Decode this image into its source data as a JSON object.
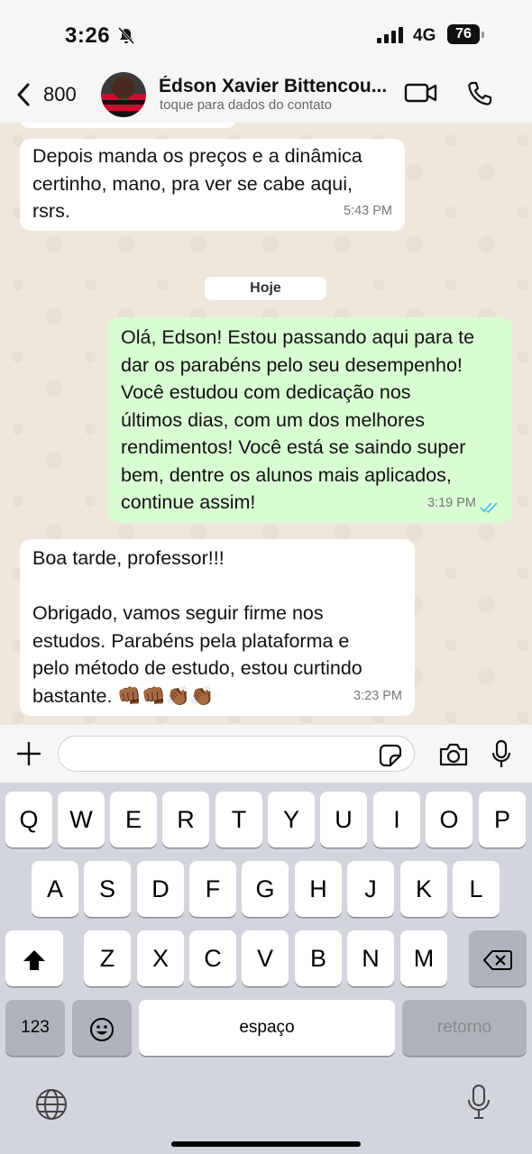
{
  "status_bar": {
    "time": "3:26",
    "network": "4G",
    "battery": "76"
  },
  "header": {
    "back_count": "800",
    "contact_name": "Édson Xavier Bittencou...",
    "contact_subtitle": "toque para dados do contato"
  },
  "messages": [
    {
      "direction": "in",
      "text": "Depois manda os preços e a dinâmica\ncertinho, mano, pra ver se cabe aqui,\nrsrs.",
      "time": "5:43 PM"
    },
    {
      "direction": "date",
      "text": "Hoje"
    },
    {
      "direction": "out",
      "text": "Olá, Edson! Estou passando aqui para te\ndar os parabéns pelo seu desempenho!\nVocê estudou com dedicação nos\núltimos dias, com um dos melhores\nrendimentos! Você está se saindo super\nbem, dentre os alunos mais aplicados,\ncontinue assim!",
      "time": "3:19 PM",
      "status": "read"
    },
    {
      "direction": "in",
      "text": "Boa tarde, professor!!!\n\nObrigado, vamos seguir firme nos\nestudos. Parabéns pela plataforma e\npelo método de estudo, estou curtindo\nbastante. 👊🏾👊🏾👏🏾👏🏾",
      "time": "3:23 PM"
    }
  ],
  "composer": {
    "value": "",
    "placeholder": ""
  },
  "keyboard": {
    "row1": [
      "Q",
      "W",
      "E",
      "R",
      "T",
      "Y",
      "U",
      "I",
      "O",
      "P"
    ],
    "row2": [
      "A",
      "S",
      "D",
      "F",
      "G",
      "H",
      "J",
      "K",
      "L"
    ],
    "row3": [
      "Z",
      "X",
      "C",
      "V",
      "B",
      "N",
      "M"
    ],
    "numbers_key": "123",
    "space_key": "espaço",
    "return_key": "retorno"
  },
  "colors": {
    "outgoing_bubble": "#d9fdd3",
    "incoming_bubble": "#ffffff",
    "read_ticks": "#53bdeb",
    "chat_background": "#efe7dc"
  },
  "icons": [
    "bell-slash-icon",
    "signal-icon",
    "back-chevron-icon",
    "video-call-icon",
    "phone-icon",
    "plus-icon",
    "sticker-icon",
    "camera-icon",
    "microphone-icon",
    "shift-icon",
    "backspace-icon",
    "emoji-icon",
    "globe-icon",
    "dictation-icon",
    "double-check-icon"
  ]
}
